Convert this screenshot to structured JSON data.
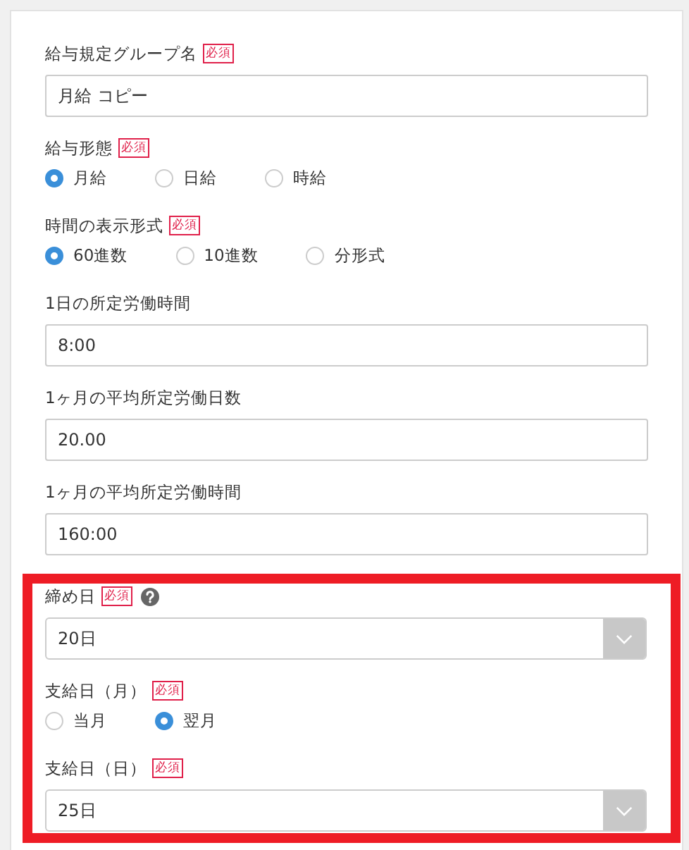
{
  "form": {
    "fields": [
      {
        "kind": "text",
        "label": "給与規定グループ名",
        "required": "必須",
        "value": "月給 コピー"
      },
      {
        "kind": "radio",
        "label": "給与形態",
        "required": "必須",
        "options": [
          {
            "label": "月給",
            "selected": true
          },
          {
            "label": "日給",
            "selected": false
          },
          {
            "label": "時給",
            "selected": false
          }
        ]
      },
      {
        "kind": "radio",
        "label": "時間の表示形式",
        "required": "必須",
        "options": [
          {
            "label": "60進数",
            "selected": true
          },
          {
            "label": "10進数",
            "selected": false
          },
          {
            "label": "分形式",
            "selected": false
          }
        ]
      },
      {
        "kind": "text",
        "label": "1日の所定労働時間",
        "value": "8:00"
      },
      {
        "kind": "text",
        "label": "1ヶ月の平均所定労働日数",
        "value": "20.00"
      },
      {
        "kind": "text",
        "label": "1ヶ月の平均所定労働時間",
        "value": "160:00"
      }
    ],
    "highlighted_fields": [
      {
        "kind": "select",
        "label": "締め日",
        "required": "必須",
        "help": true,
        "value": "20日"
      },
      {
        "kind": "radio",
        "label": "支給日（月）",
        "required": "必須",
        "options": [
          {
            "label": "当月",
            "selected": false
          },
          {
            "label": "翌月",
            "selected": true
          }
        ]
      },
      {
        "kind": "select",
        "label": "支給日（日）",
        "required": "必須",
        "value": "25日"
      }
    ]
  }
}
